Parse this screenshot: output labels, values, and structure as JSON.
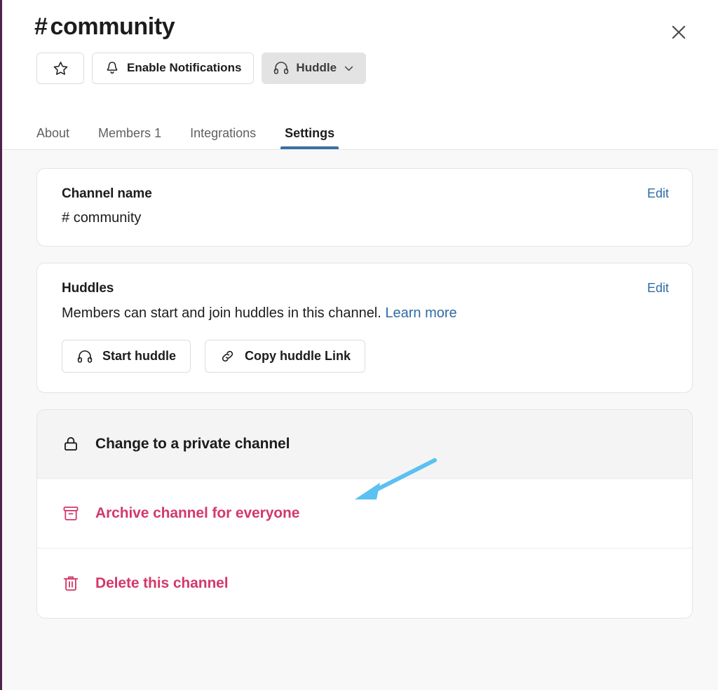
{
  "header": {
    "channel_hash": "#",
    "channel_name": "community",
    "close_icon": "close-icon",
    "buttons": [
      {
        "name": "star",
        "icon": "star-icon",
        "label": ""
      },
      {
        "name": "notifications",
        "icon": "bell-icon",
        "label": "Enable Notifications"
      },
      {
        "name": "huddle",
        "icon": "headphones-icon",
        "label": "Huddle",
        "chevron": "chevron-down-icon"
      }
    ],
    "tabs": [
      {
        "label": "About",
        "count": "",
        "active": false
      },
      {
        "label": "Members",
        "count": "1",
        "active": false
      },
      {
        "label": "Integrations",
        "count": "",
        "active": false
      },
      {
        "label": "Settings",
        "count": "",
        "active": true
      }
    ]
  },
  "cards": {
    "channel_name": {
      "title": "Channel name",
      "edit_label": "Edit",
      "value_hash": "#",
      "value": "community"
    },
    "huddles": {
      "title": "Huddles",
      "edit_label": "Edit",
      "description": "Members can start and join huddles in this channel.",
      "learn_more_label": "Learn more",
      "start_button": "Start huddle",
      "start_icon": "headphones-icon",
      "copy_button": "Copy huddle Link",
      "copy_icon": "link-icon"
    }
  },
  "danger_rows": [
    {
      "icon": "lock-icon",
      "label": "Change to a private channel",
      "tone": "neutral",
      "hovered": true
    },
    {
      "icon": "archive-icon",
      "label": "Archive channel for everyone",
      "tone": "destructive",
      "hovered": false
    },
    {
      "icon": "trash-icon",
      "label": "Delete this channel",
      "tone": "destructive",
      "hovered": false
    }
  ],
  "colors": {
    "accent_blue": "#2f6ba6",
    "tab_underline": "#3b6ea5",
    "destructive": "#d3396a",
    "annotation_arrow": "#5cc0f0",
    "page_background": "#f8f8f8",
    "card_background": "#ffffff"
  },
  "annotation": {
    "type": "arrow",
    "points_to": "Change to a private channel",
    "color": "#5cc0f0"
  }
}
